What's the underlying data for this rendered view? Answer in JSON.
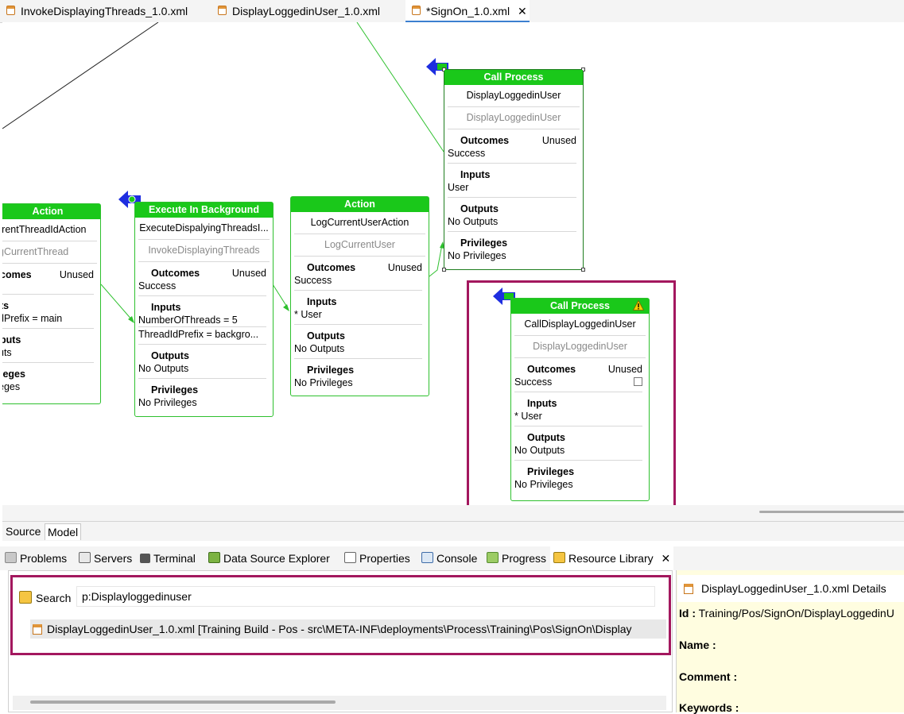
{
  "editor_tabs": [
    {
      "label": "InvokeDisplayingThreads_1.0.xml"
    },
    {
      "label": "DisplayLoggedinUser_1.0.xml"
    },
    {
      "label": "*SignOn_1.0.xml",
      "close": "✕"
    }
  ],
  "nodes": {
    "action_left": {
      "header": "Action",
      "name": "rrentThreadIdAction",
      "ref": "gCurrentThread",
      "outcomes_title": "comes",
      "outcomes_unused": "Unused",
      "inputs_title": "ts",
      "inputs_value": "dPrefix = main",
      "outputs_title": "puts",
      "outputs_value": "uts",
      "privileges_title": "leges",
      "privileges_value": "eges"
    },
    "execute_bg": {
      "header": "Execute In Background",
      "name": "ExecuteDispalyingThreadsI...",
      "ref": "InvokeDisplayingThreads",
      "outcomes_title": "Outcomes",
      "outcomes_unused": "Unused",
      "outcomes_value": "Success",
      "inputs_title": "Inputs",
      "inputs_values": [
        "NumberOfThreads = 5",
        "ThreadIdPrefix = backgro..."
      ],
      "outputs_title": "Outputs",
      "outputs_value": "No Outputs",
      "privileges_title": "Privileges",
      "privileges_value": "No Privileges"
    },
    "action_mid": {
      "header": "Action",
      "name": "LogCurrentUserAction",
      "ref": "LogCurrentUser",
      "outcomes_title": "Outcomes",
      "outcomes_unused": "Unused",
      "outcomes_value": "Success",
      "inputs_title": "Inputs",
      "inputs_value": "* User",
      "outputs_title": "Outputs",
      "outputs_value": "No Outputs",
      "privileges_title": "Privileges",
      "privileges_value": "No Privileges"
    },
    "call_process_top": {
      "header": "Call Process",
      "name": "DisplayLoggedinUser",
      "ref": "DisplayLoggedinUser",
      "outcomes_title": "Outcomes",
      "outcomes_unused": "Unused",
      "outcomes_value": "Success",
      "inputs_title": "Inputs",
      "inputs_value": "User",
      "outputs_title": "Outputs",
      "outputs_value": "No Outputs",
      "privileges_title": "Privileges",
      "privileges_value": "No Privileges"
    },
    "call_process_new": {
      "header": "Call Process",
      "name": "CallDisplayLoggedinUser",
      "ref": "DisplayLoggedinUser",
      "outcomes_title": "Outcomes",
      "outcomes_unused": "Unused",
      "outcomes_value": "Success",
      "inputs_title": "Inputs",
      "inputs_value": "* User",
      "outputs_title": "Outputs",
      "outputs_value": "No Outputs",
      "privileges_title": "Privileges",
      "privileges_value": "No Privileges"
    }
  },
  "source_model_tabs": [
    {
      "label": "Source"
    },
    {
      "label": "Model"
    }
  ],
  "view_tabs": [
    {
      "label": "Problems",
      "icon": "problems-icon"
    },
    {
      "label": "Servers",
      "icon": "servers-icon"
    },
    {
      "label": "Terminal",
      "icon": "terminal-icon"
    },
    {
      "label": "Data Source Explorer",
      "icon": "data-source-icon"
    },
    {
      "label": "Properties",
      "icon": "properties-icon"
    },
    {
      "label": "Console",
      "icon": "console-icon"
    },
    {
      "label": "Progress",
      "icon": "progress-icon"
    },
    {
      "label": "Resource Library",
      "icon": "resource-library-icon",
      "close": "✕"
    }
  ],
  "resource_library": {
    "search_label": "Search",
    "search_value": "p:Displayloggedinuser",
    "result": "DisplayLoggedinUser_1.0.xml [Training Build - Pos - src\\META-INF\\deployments\\Process\\Training\\Pos\\SignOn\\Display"
  },
  "details": {
    "title": "DisplayLoggedinUser_1.0.xml Details",
    "id_label": "Id :",
    "id_value": "Training/Pos/SignOn/DisplayLoggedinU",
    "name_label": "Name :",
    "comment_label": "Comment :",
    "keywords_label": "Keywords :"
  },
  "colors": {
    "node_header": "#1ac81a",
    "node_border": "#2ec02e",
    "highlight": "#a3175e",
    "details_bg": "#fffde0"
  }
}
